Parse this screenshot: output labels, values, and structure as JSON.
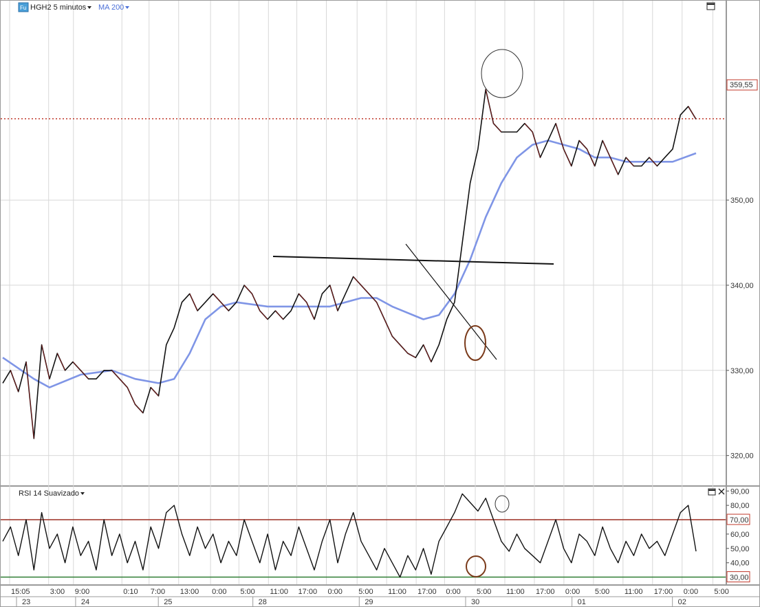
{
  "toolbar": {
    "symbol_label": "HGH2 5 minutos",
    "indicator_label": "MA 200",
    "rsi_label": "RSI 14 Suavizado",
    "symbol_badge": "Fu"
  },
  "colors": {
    "price": "#111111",
    "price_down_fill": "#8b1a1a",
    "ma": "#7f95e6",
    "reference_line": "#c0392b",
    "overbought": "#9b2d20",
    "oversold": "#2e7d32",
    "trendline": "#111111",
    "circle_highlight": "#7a3a1a",
    "grid": "#d8d8d8"
  },
  "chart_data": [
    {
      "type": "line",
      "panel": "price",
      "y_ticks": [
        "320,00",
        "330,00",
        "340,00",
        "350,00"
      ],
      "ylim": [
        316.5,
        373.5
      ],
      "current_price_label": "359,55",
      "current_price": 359.55,
      "series": [
        {
          "name": "HGH2 5 minutos",
          "points": [
            [
              0,
              328.5
            ],
            [
              1,
              330
            ],
            [
              2,
              327.5
            ],
            [
              3,
              331
            ],
            [
              4,
              322
            ],
            [
              5,
              333
            ],
            [
              6,
              329
            ],
            [
              7,
              332
            ],
            [
              8,
              330
            ],
            [
              9,
              331
            ],
            [
              10,
              330
            ],
            [
              11,
              329
            ],
            [
              12,
              329
            ],
            [
              13,
              330
            ],
            [
              14,
              330
            ],
            [
              15,
              329
            ],
            [
              16,
              328
            ],
            [
              17,
              326
            ],
            [
              18,
              325
            ],
            [
              19,
              328
            ],
            [
              20,
              327
            ],
            [
              21,
              333
            ],
            [
              22,
              335
            ],
            [
              23,
              338
            ],
            [
              24,
              339
            ],
            [
              25,
              337
            ],
            [
              26,
              338
            ],
            [
              27,
              339
            ],
            [
              28,
              338
            ],
            [
              29,
              337
            ],
            [
              30,
              338
            ],
            [
              31,
              340
            ],
            [
              32,
              339
            ],
            [
              33,
              337
            ],
            [
              34,
              336
            ],
            [
              35,
              337
            ],
            [
              36,
              336
            ],
            [
              37,
              337
            ],
            [
              38,
              339
            ],
            [
              39,
              338
            ],
            [
              40,
              336
            ],
            [
              41,
              339
            ],
            [
              42,
              340
            ],
            [
              43,
              337
            ],
            [
              44,
              339
            ],
            [
              45,
              341
            ],
            [
              46,
              340
            ],
            [
              47,
              339
            ],
            [
              48,
              338
            ],
            [
              49,
              336
            ],
            [
              50,
              334
            ],
            [
              51,
              333
            ],
            [
              52,
              332
            ],
            [
              53,
              331.5
            ],
            [
              54,
              333
            ],
            [
              55,
              331
            ],
            [
              56,
              333
            ],
            [
              57,
              336
            ],
            [
              58,
              338
            ],
            [
              59,
              345
            ],
            [
              60,
              352
            ],
            [
              61,
              356
            ],
            [
              62,
              363
            ],
            [
              63,
              359
            ],
            [
              64,
              358
            ],
            [
              65,
              358
            ],
            [
              66,
              358
            ],
            [
              67,
              359
            ],
            [
              68,
              358
            ],
            [
              69,
              355
            ],
            [
              70,
              357
            ],
            [
              71,
              359
            ],
            [
              72,
              356
            ],
            [
              73,
              354
            ],
            [
              74,
              357
            ],
            [
              75,
              356
            ],
            [
              76,
              354
            ],
            [
              77,
              357
            ],
            [
              78,
              355
            ],
            [
              79,
              353
            ],
            [
              80,
              355
            ],
            [
              81,
              354
            ],
            [
              82,
              354
            ],
            [
              83,
              355
            ],
            [
              84,
              354
            ],
            [
              85,
              355
            ],
            [
              86,
              356
            ],
            [
              87,
              360
            ],
            [
              88,
              361
            ],
            [
              89,
              359.5
            ]
          ]
        },
        {
          "name": "MA 200",
          "points": [
            [
              0,
              331.5
            ],
            [
              4,
              329
            ],
            [
              6,
              328
            ],
            [
              10,
              329.5
            ],
            [
              14,
              330
            ],
            [
              17,
              329
            ],
            [
              20,
              328.5
            ],
            [
              22,
              329
            ],
            [
              24,
              332
            ],
            [
              26,
              336
            ],
            [
              28,
              337.5
            ],
            [
              30,
              338
            ],
            [
              34,
              337.5
            ],
            [
              38,
              337.5
            ],
            [
              42,
              337.5
            ],
            [
              46,
              338.5
            ],
            [
              48,
              338.5
            ],
            [
              50,
              337.5
            ],
            [
              54,
              336
            ],
            [
              56,
              336.5
            ],
            [
              58,
              339
            ],
            [
              60,
              343
            ],
            [
              62,
              348
            ],
            [
              64,
              352
            ],
            [
              66,
              355
            ],
            [
              68,
              356.5
            ],
            [
              70,
              357
            ],
            [
              72,
              356.5
            ],
            [
              74,
              356
            ],
            [
              76,
              355
            ],
            [
              78,
              355
            ],
            [
              80,
              354.5
            ],
            [
              82,
              354.5
            ],
            [
              84,
              354.5
            ],
            [
              86,
              354.5
            ],
            [
              89,
              355.5
            ]
          ]
        }
      ]
    },
    {
      "type": "line",
      "panel": "rsi",
      "y_ticks": [
        "40,00",
        "50,00",
        "60,00",
        "70,00",
        "80,00",
        "90,00"
      ],
      "ylim": [
        25,
        93
      ],
      "thresholds": [
        {
          "label": "70,00",
          "value": 70
        },
        {
          "label": "30,00",
          "value": 30
        }
      ],
      "series": [
        {
          "name": "RSI 14 Suavizado",
          "points": [
            [
              0,
              55
            ],
            [
              1,
              65
            ],
            [
              2,
              45
            ],
            [
              3,
              70
            ],
            [
              4,
              35
            ],
            [
              5,
              75
            ],
            [
              6,
              50
            ],
            [
              7,
              60
            ],
            [
              8,
              40
            ],
            [
              9,
              65
            ],
            [
              10,
              45
            ],
            [
              11,
              55
            ],
            [
              12,
              35
            ],
            [
              13,
              70
            ],
            [
              14,
              45
            ],
            [
              15,
              60
            ],
            [
              16,
              40
            ],
            [
              17,
              55
            ],
            [
              18,
              35
            ],
            [
              19,
              65
            ],
            [
              20,
              50
            ],
            [
              21,
              75
            ],
            [
              22,
              80
            ],
            [
              23,
              60
            ],
            [
              24,
              45
            ],
            [
              25,
              65
            ],
            [
              26,
              50
            ],
            [
              27,
              60
            ],
            [
              28,
              40
            ],
            [
              29,
              55
            ],
            [
              30,
              45
            ],
            [
              31,
              70
            ],
            [
              32,
              55
            ],
            [
              33,
              40
            ],
            [
              34,
              60
            ],
            [
              35,
              35
            ],
            [
              36,
              55
            ],
            [
              37,
              45
            ],
            [
              38,
              65
            ],
            [
              39,
              50
            ],
            [
              40,
              35
            ],
            [
              41,
              55
            ],
            [
              42,
              70
            ],
            [
              43,
              40
            ],
            [
              44,
              60
            ],
            [
              45,
              75
            ],
            [
              46,
              55
            ],
            [
              47,
              45
            ],
            [
              48,
              35
            ],
            [
              49,
              50
            ],
            [
              50,
              40
            ],
            [
              51,
              30
            ],
            [
              52,
              45
            ],
            [
              53,
              35
            ],
            [
              54,
              50
            ],
            [
              55,
              32
            ],
            [
              56,
              55
            ],
            [
              57,
              65
            ],
            [
              58,
              75
            ],
            [
              59,
              88
            ],
            [
              60,
              82
            ],
            [
              61,
              76
            ],
            [
              62,
              85
            ],
            [
              63,
              70
            ],
            [
              64,
              55
            ],
            [
              65,
              48
            ],
            [
              66,
              60
            ],
            [
              67,
              50
            ],
            [
              68,
              45
            ],
            [
              69,
              40
            ],
            [
              70,
              55
            ],
            [
              71,
              70
            ],
            [
              72,
              50
            ],
            [
              73,
              40
            ],
            [
              74,
              60
            ],
            [
              75,
              55
            ],
            [
              76,
              45
            ],
            [
              77,
              65
            ],
            [
              78,
              50
            ],
            [
              79,
              40
            ],
            [
              80,
              55
            ],
            [
              81,
              45
            ],
            [
              82,
              60
            ],
            [
              83,
              50
            ],
            [
              84,
              55
            ],
            [
              85,
              45
            ],
            [
              86,
              60
            ],
            [
              87,
              75
            ],
            [
              88,
              80
            ],
            [
              89,
              48
            ]
          ]
        }
      ]
    }
  ],
  "time_axis": {
    "time_ticks": [
      {
        "label": "15:05",
        "x": 0
      },
      {
        "label": "3:00",
        "x": 3.3
      },
      {
        "label": "9:00",
        "x": 5.4
      },
      {
        "label": "0:10",
        "x": 9.5
      },
      {
        "label": "7:00",
        "x": 11.8
      },
      {
        "label": "13:00",
        "x": 14.3
      },
      {
        "label": "0:00",
        "x": 17
      },
      {
        "label": "5:00",
        "x": 19.4
      },
      {
        "label": "11:00",
        "x": 21.9
      },
      {
        "label": "17:00",
        "x": 24.3
      },
      {
        "label": "0:00",
        "x": 26.8
      },
      {
        "label": "5:00",
        "x": 29.4
      },
      {
        "label": "11:00",
        "x": 31.9
      },
      {
        "label": "17:00",
        "x": 34.4
      },
      {
        "label": "0:00",
        "x": 36.8
      },
      {
        "label": "5:00",
        "x": 39.4
      },
      {
        "label": "11:00",
        "x": 41.9
      },
      {
        "label": "17:00",
        "x": 44.4
      },
      {
        "label": "0:00",
        "x": 46.9
      },
      {
        "label": "5:00",
        "x": 49.4
      },
      {
        "label": "11:00",
        "x": 51.9
      },
      {
        "label": "17:00",
        "x": 54.4
      },
      {
        "label": "0:00",
        "x": 56.9
      },
      {
        "label": "5:00",
        "x": 59.5
      }
    ],
    "date_ticks": [
      {
        "label": "23",
        "x": 0
      },
      {
        "label": "24",
        "x": 5.0
      },
      {
        "label": "25",
        "x": 12.0
      },
      {
        "label": "28",
        "x": 20.0
      },
      {
        "label": "29",
        "x": 29.0
      },
      {
        "label": "30",
        "x": 38.0
      },
      {
        "label": "01",
        "x": 47.0
      },
      {
        "label": "02",
        "x": 55.5
      }
    ]
  }
}
